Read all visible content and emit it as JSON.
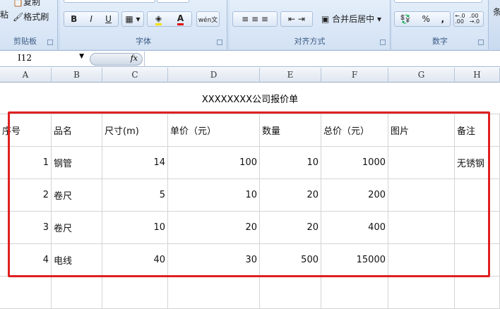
{
  "ribbon": {
    "clipboard": {
      "label": "剪贴板",
      "paste": "粘",
      "copy": "复制",
      "format_painter": "格式刷"
    },
    "font": {
      "label": "字体",
      "bold": "B",
      "italic": "I",
      "underline": "U",
      "font_color": "A",
      "phonetic": "wén文",
      "fill_color": "#f5e000",
      "text_color": "#e00000"
    },
    "alignment": {
      "label": "对齐方式",
      "merge_center": "合并后居中"
    },
    "number": {
      "label": "数字",
      "percent": "%",
      "comma": ",",
      "inc_decimal": "←.0 .00",
      "dec_decimal": ".00 →.0"
    },
    "styles_partial": "条"
  },
  "formula_bar": {
    "name_box": "I12",
    "fx": "fx",
    "value": ""
  },
  "columns": [
    "A",
    "B",
    "C",
    "D",
    "E",
    "F",
    "G",
    "H"
  ],
  "sheet": {
    "title": "XXXXXXXX公司报价单",
    "headers": [
      "序号",
      "品名",
      "尺寸(m)",
      "单价（元）",
      "数量",
      "总价（元）",
      "图片",
      "备注"
    ],
    "rows": [
      [
        "1",
        "钢管",
        "14",
        "100",
        "10",
        "1000",
        "",
        "无锈钢"
      ],
      [
        "2",
        "卷尺",
        "5",
        "10",
        "20",
        "200",
        "",
        ""
      ],
      [
        "3",
        "卷尺",
        "10",
        "20",
        "20",
        "400",
        "",
        ""
      ],
      [
        "4",
        "电线",
        "40",
        "30",
        "500",
        "15000",
        "",
        ""
      ]
    ]
  },
  "highlight_color": "#e02020"
}
